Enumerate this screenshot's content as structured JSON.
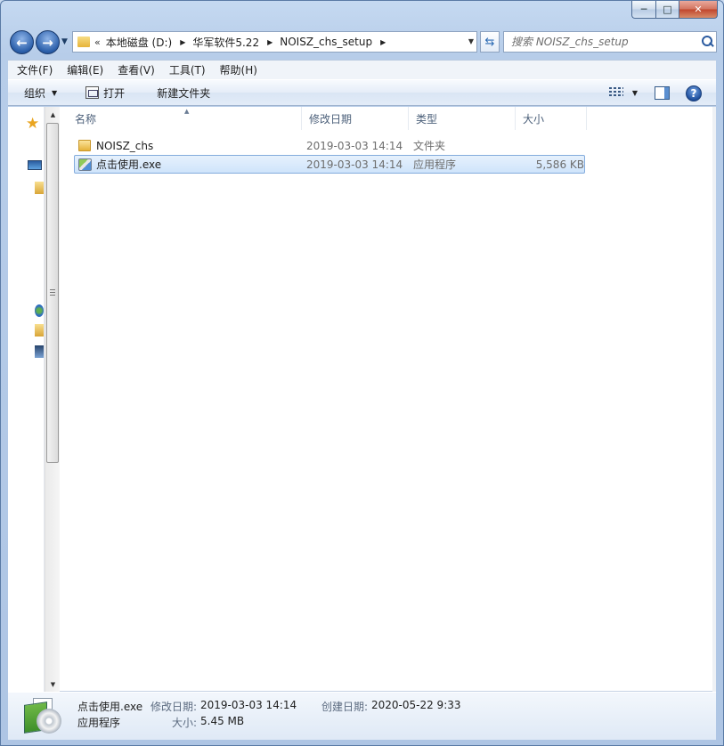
{
  "window": {
    "caption": {
      "minimize": "─",
      "maximize": "□",
      "close": "✕"
    }
  },
  "address": {
    "chevron": "«",
    "crumbs": [
      "本地磁盘 (D:)",
      "华军软件5.22",
      "NOISZ_chs_setup"
    ]
  },
  "search": {
    "placeholder": "搜索 NOISZ_chs_setup"
  },
  "menubar": [
    "文件(F)",
    "编辑(E)",
    "查看(V)",
    "工具(T)",
    "帮助(H)"
  ],
  "commandbar": {
    "organize": "组织",
    "open": "打开",
    "new_folder": "新建文件夹"
  },
  "columns": {
    "name": "名称",
    "date": "修改日期",
    "type": "类型",
    "size": "大小"
  },
  "files": [
    {
      "name": "NOISZ_chs",
      "date": "2019-03-03 14:14",
      "type": "文件夹",
      "size": "",
      "kind": "folder",
      "selected": false
    },
    {
      "name": "点击使用.exe",
      "date": "2019-03-03 14:14",
      "type": "应用程序",
      "size": "5,586 KB",
      "kind": "exe",
      "selected": true
    }
  ],
  "details": {
    "name": "点击使用.exe",
    "type": "应用程序",
    "modified_label": "修改日期:",
    "modified_value": "2019-03-03 14:14",
    "created_label": "创建日期:",
    "created_value": "2020-05-22 9:33",
    "size_label": "大小:",
    "size_value": "5.45 MB"
  }
}
